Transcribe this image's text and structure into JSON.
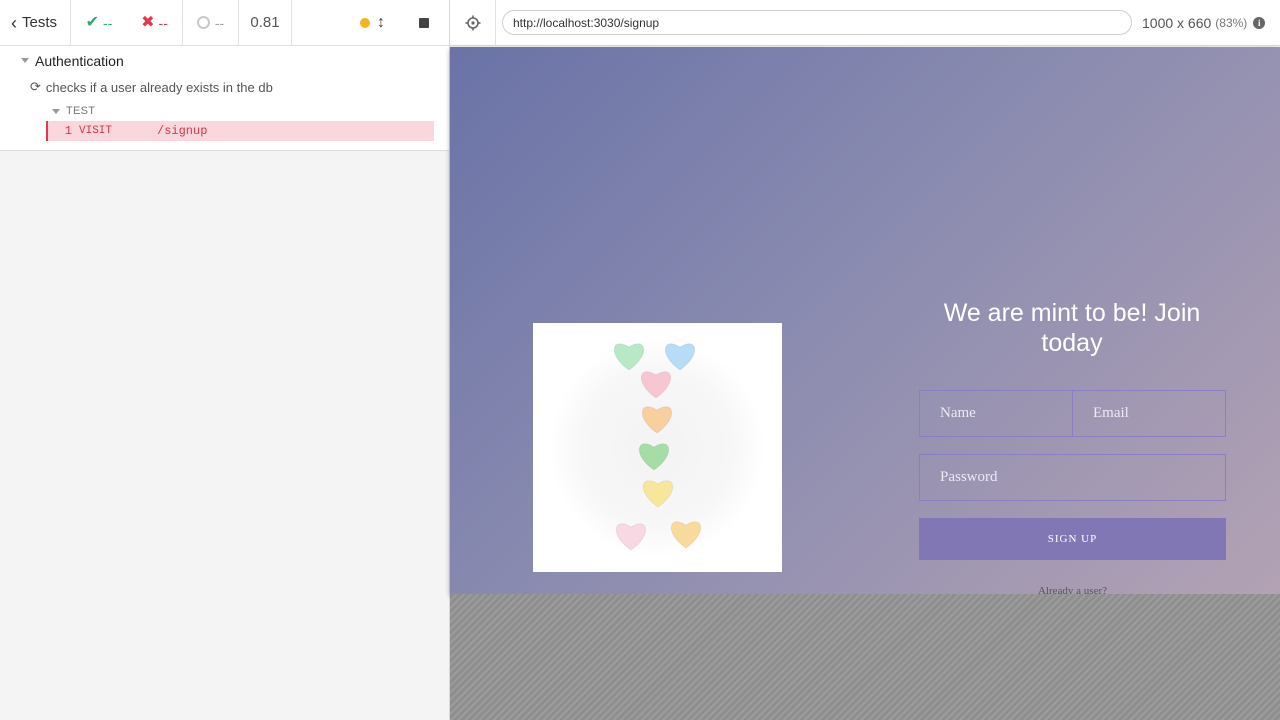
{
  "reporter": {
    "back_label": "Tests",
    "passed": "--",
    "failed": "--",
    "pending": "--",
    "duration": "0.81",
    "suite_title": "Authentication",
    "test_title": "checks if a user already exists in the db",
    "section_label": "TEST",
    "command": {
      "number": "1",
      "name": "VISIT",
      "message": "/signup"
    }
  },
  "browser": {
    "url": "http://localhost:3030/signup",
    "viewport": "1000 x 660",
    "scale": "(83%)",
    "info_glyph": "i"
  },
  "app": {
    "title": "We are mint to be! Join today",
    "name_placeholder": "Name",
    "email_placeholder": "Email",
    "password_placeholder": "Password",
    "signup_label": "SIGN UP",
    "already_text": "Already a user?",
    "hearts_image": "candy-hearts-image"
  },
  "colors": {
    "pass": "#2eaa6d",
    "fail": "#e2394a",
    "running": "#f4b31f",
    "signup_button": "#8277b5"
  }
}
